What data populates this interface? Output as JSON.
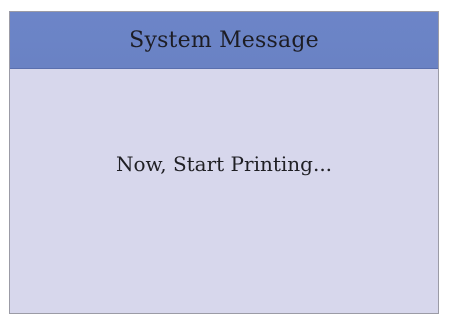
{
  "dialog": {
    "title": "System Message",
    "message": "Now, Start Printing..."
  },
  "colors": {
    "titlebar": "#6a82c4",
    "body": "#d7d7ec",
    "text": "#1f1f24"
  }
}
